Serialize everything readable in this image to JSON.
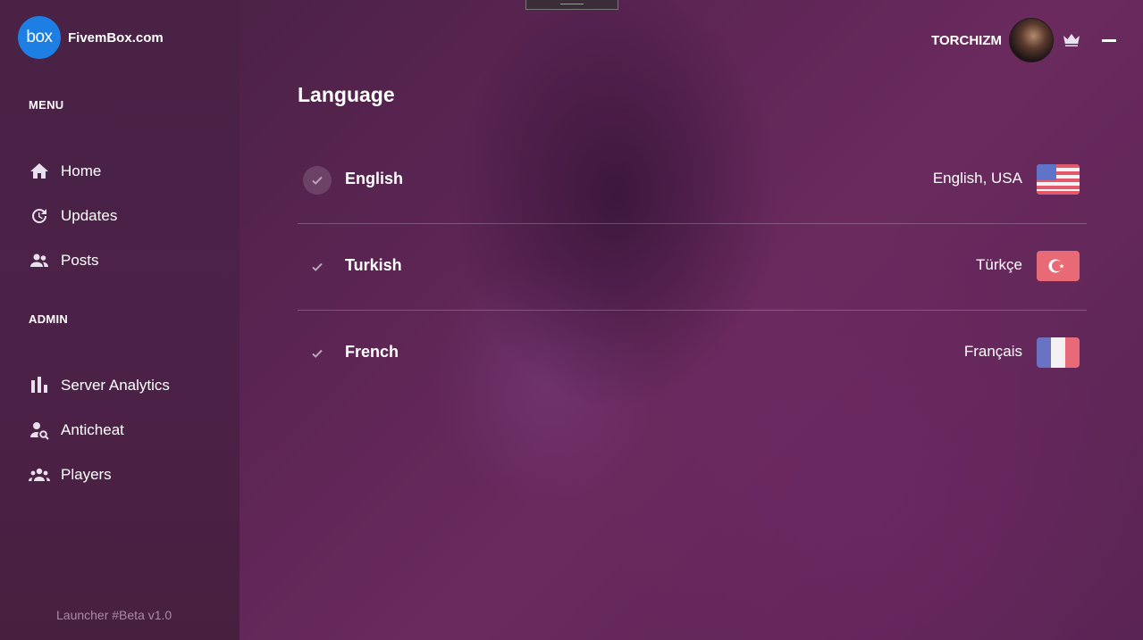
{
  "brand": {
    "logo_text": "box",
    "name": "FivemBox.com"
  },
  "sidebar": {
    "menu_title": "MENU",
    "menu_items": [
      {
        "label": "Home",
        "icon": "home-icon"
      },
      {
        "label": "Updates",
        "icon": "updates-icon"
      },
      {
        "label": "Posts",
        "icon": "posts-icon"
      }
    ],
    "admin_title": "ADMIN",
    "admin_items": [
      {
        "label": "Server Analytics",
        "icon": "analytics-icon"
      },
      {
        "label": "Anticheat",
        "icon": "anticheat-icon"
      },
      {
        "label": "Players",
        "icon": "players-icon"
      }
    ],
    "version": "Launcher #Beta v1.0"
  },
  "user": {
    "name": "TORCHIZM",
    "badge": "crown-icon"
  },
  "page": {
    "title": "Language",
    "languages": [
      {
        "name": "English",
        "native": "English, USA",
        "flag": "us-flag-icon",
        "selected": true
      },
      {
        "name": "Turkish",
        "native": "Türkçe",
        "flag": "tr-flag-icon",
        "selected": false
      },
      {
        "name": "French",
        "native": "Français",
        "flag": "fr-flag-icon",
        "selected": false
      }
    ]
  },
  "colors": {
    "logo_blue": "#1d7fe3",
    "muted_text": "#a98ca7",
    "background": "#5a2452"
  }
}
